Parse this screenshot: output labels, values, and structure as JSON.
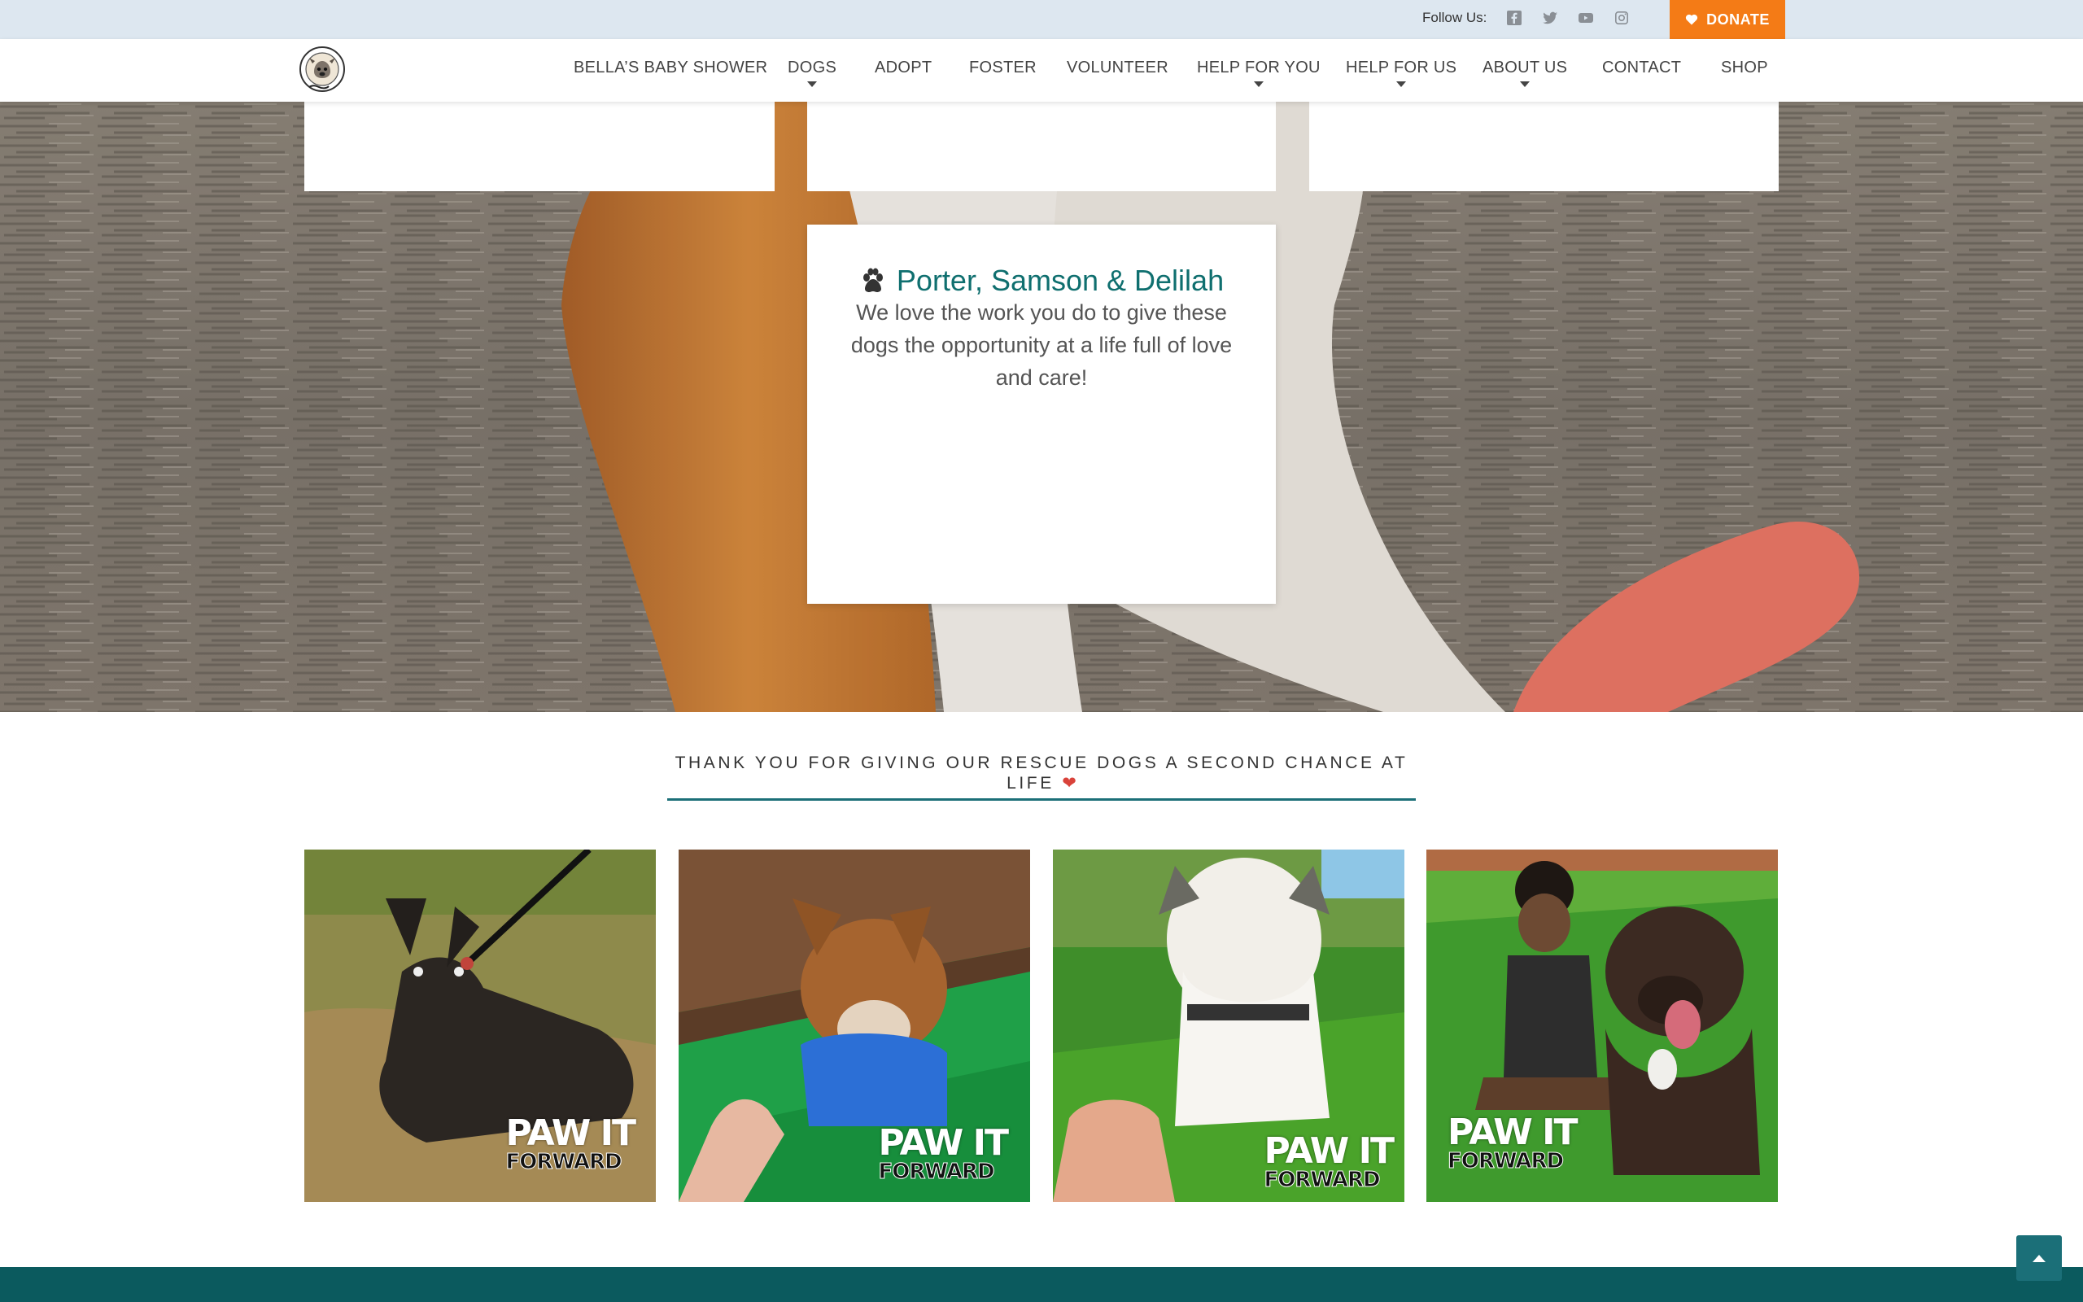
{
  "topbar": {
    "follow_label": "Follow Us:",
    "social_icons": [
      "facebook-icon",
      "twitter-icon",
      "youtube-icon",
      "instagram-icon"
    ],
    "donate_label": "DONATE"
  },
  "nav": {
    "items": [
      {
        "label": "BELLA’S BABY SHOWER",
        "has_dropdown": false
      },
      {
        "label": "DOGS",
        "has_dropdown": true
      },
      {
        "label": "ADOPT",
        "has_dropdown": false
      },
      {
        "label": "FOSTER",
        "has_dropdown": false
      },
      {
        "label": "VOLUNTEER",
        "has_dropdown": false
      },
      {
        "label": "HELP FOR YOU",
        "has_dropdown": true
      },
      {
        "label": "HELP FOR US",
        "has_dropdown": true
      },
      {
        "label": "ABOUT US",
        "has_dropdown": true
      },
      {
        "label": "CONTACT",
        "has_dropdown": false
      },
      {
        "label": "SHOP",
        "has_dropdown": false
      }
    ]
  },
  "testimonial": {
    "title": "Porter, Samson & Delilah",
    "body": "We love the work you do to give these dogs the opportunity at a life full of love and care!"
  },
  "thanks": {
    "text": "THANK YOU FOR GIVING OUR RESCUE DOGS A SECOND CHANCE AT LIFE"
  },
  "gallery": {
    "photos": [
      {
        "main": "PAW IT",
        "sub": "FORWARD"
      },
      {
        "main": "PAW IT",
        "sub": "FORWARD"
      },
      {
        "main": "PAW IT",
        "sub": "FORWARD"
      },
      {
        "main": "PAW IT",
        "sub": "FORWARD"
      }
    ]
  },
  "colors": {
    "accent_orange": "#f47b16",
    "teal": "#0f6f6f",
    "footer_teal": "#0b5a5e",
    "topbar_bg": "#dde7f0"
  }
}
